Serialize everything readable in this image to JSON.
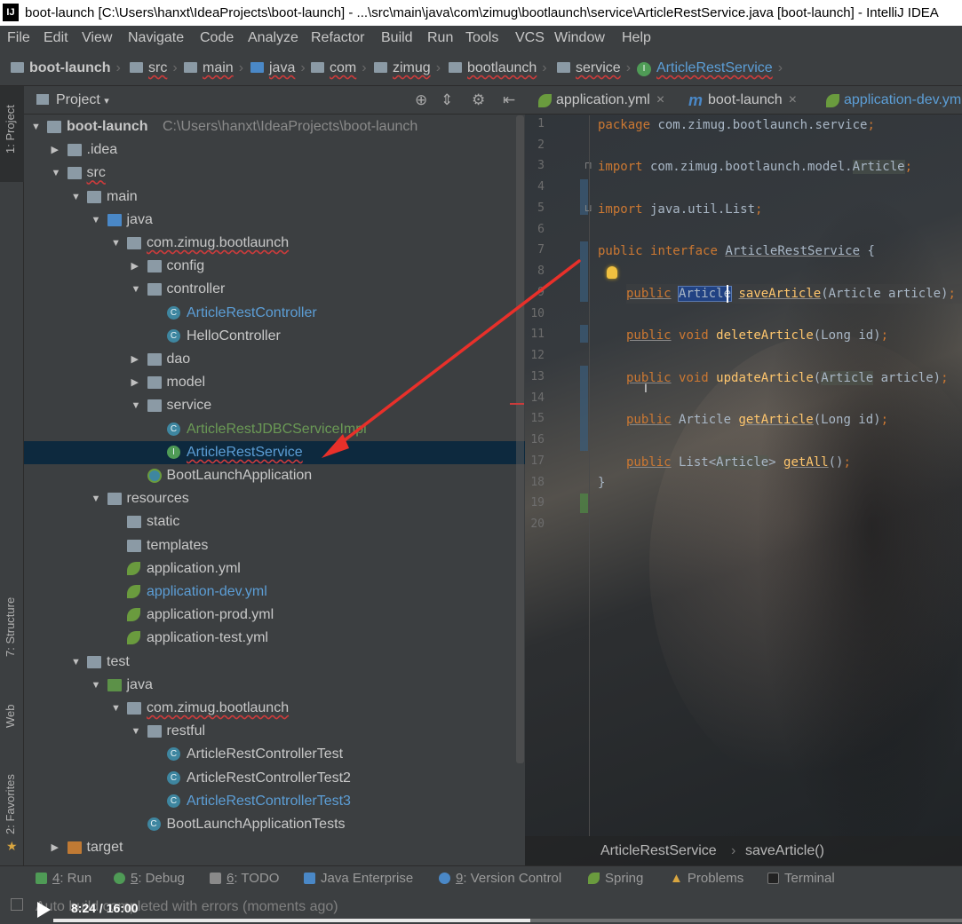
{
  "window": {
    "title": "boot-launch [C:\\Users\\hanxt\\IdeaProjects\\boot-launch] - ...\\src\\main\\java\\com\\zimug\\bootlaunch\\service\\ArticleRestService.java [boot-launch] - IntelliJ IDEA"
  },
  "menu": [
    "File",
    "Edit",
    "View",
    "Navigate",
    "Code",
    "Analyze",
    "Refactor",
    "Build",
    "Run",
    "Tools",
    "VCS",
    "Window",
    "Help"
  ],
  "breadcrumbs": [
    "boot-launch",
    "src",
    "main",
    "java",
    "com",
    "zimug",
    "bootlaunch",
    "service",
    "ArticleRestService"
  ],
  "left_strip": {
    "project": "1: Project",
    "structure": "7: Structure",
    "web": "Web",
    "favorites": "2: Favorites"
  },
  "project_panel": {
    "title": "Project",
    "tree": [
      {
        "label": "boot-launch",
        "path": "C:\\Users\\hanxt\\IdeaProjects\\boot-launch",
        "level": 0,
        "expanded": true,
        "icon": "folder"
      },
      {
        "label": ".idea",
        "level": 1,
        "expanded": false,
        "icon": "folder"
      },
      {
        "label": "src",
        "level": 1,
        "expanded": true,
        "icon": "folder"
      },
      {
        "label": "main",
        "level": 2,
        "expanded": true,
        "icon": "folder"
      },
      {
        "label": "java",
        "level": 3,
        "expanded": true,
        "icon": "folder-blue"
      },
      {
        "label": "com.zimug.bootlaunch",
        "level": 4,
        "expanded": true,
        "icon": "folder"
      },
      {
        "label": "config",
        "level": 5,
        "expanded": false,
        "icon": "folder"
      },
      {
        "label": "controller",
        "level": 5,
        "expanded": true,
        "icon": "folder"
      },
      {
        "label": "ArticleRestController",
        "level": 6,
        "icon": "class",
        "color": "blue"
      },
      {
        "label": "HelloController",
        "level": 6,
        "icon": "class"
      },
      {
        "label": "dao",
        "level": 5,
        "expanded": false,
        "icon": "folder"
      },
      {
        "label": "model",
        "level": 5,
        "expanded": false,
        "icon": "folder"
      },
      {
        "label": "service",
        "level": 5,
        "expanded": true,
        "icon": "folder"
      },
      {
        "label": "ArticleRestJDBCServiceImpl",
        "level": 6,
        "icon": "class",
        "color": "green"
      },
      {
        "label": "ArticleRestService",
        "level": 6,
        "icon": "interface",
        "color": "blue",
        "selected": true
      },
      {
        "label": "BootLaunchApplication",
        "level": 5,
        "icon": "app"
      },
      {
        "label": "resources",
        "level": 3,
        "expanded": true,
        "icon": "folder"
      },
      {
        "label": "static",
        "level": 4,
        "icon": "folder"
      },
      {
        "label": "templates",
        "level": 4,
        "icon": "folder"
      },
      {
        "label": "application.yml",
        "level": 4,
        "icon": "yml"
      },
      {
        "label": "application-dev.yml",
        "level": 4,
        "icon": "yml",
        "color": "blue"
      },
      {
        "label": "application-prod.yml",
        "level": 4,
        "icon": "yml"
      },
      {
        "label": "application-test.yml",
        "level": 4,
        "icon": "yml"
      },
      {
        "label": "test",
        "level": 2,
        "expanded": true,
        "icon": "folder"
      },
      {
        "label": "java",
        "level": 3,
        "expanded": true,
        "icon": "folder-green"
      },
      {
        "label": "com.zimug.bootlaunch",
        "level": 4,
        "expanded": true,
        "icon": "folder"
      },
      {
        "label": "restful",
        "level": 5,
        "expanded": true,
        "icon": "folder"
      },
      {
        "label": "ArticleRestControllerTest",
        "level": 6,
        "icon": "class"
      },
      {
        "label": "ArticleRestControllerTest2",
        "level": 6,
        "icon": "class"
      },
      {
        "label": "ArticleRestControllerTest3",
        "level": 6,
        "icon": "class",
        "color": "blue"
      },
      {
        "label": "BootLaunchApplicationTests",
        "level": 5,
        "icon": "class"
      },
      {
        "label": "target",
        "level": 1,
        "expanded": false,
        "icon": "folder-orange"
      }
    ]
  },
  "editor": {
    "tabs": [
      {
        "label": "application.yml",
        "icon": "yml"
      },
      {
        "label": "boot-launch",
        "icon": "maven"
      },
      {
        "label": "application-dev.yml",
        "icon": "yml"
      }
    ],
    "line_numbers": [
      "1",
      "2",
      "3",
      "4",
      "5",
      "6",
      "7",
      "8",
      "9",
      "10",
      "11",
      "12",
      "13",
      "14",
      "15",
      "16",
      "17",
      "18",
      "19",
      "20"
    ],
    "code": {
      "l1": [
        "package",
        " com.zimug.bootlaunch.service",
        ";"
      ],
      "l3": [
        "import",
        " com.zimug.bootlaunch.model.",
        "Article",
        ";"
      ],
      "l5": [
        "import",
        " java.util.List",
        ";"
      ],
      "l7": [
        "public",
        " ",
        "interface",
        " ",
        "ArticleRestService",
        " {"
      ],
      "l9": [
        "public",
        " ",
        "Article",
        " ",
        "saveArticle",
        "(Article article)",
        ";"
      ],
      "l11": [
        "public",
        " ",
        "void",
        " ",
        "deleteArticle",
        "(Long id)",
        ";"
      ],
      "l13": [
        "public",
        " ",
        "void",
        " ",
        "updateArticle",
        "(",
        "Article",
        " article)",
        ";"
      ],
      "l15": [
        "public",
        " Article ",
        "getArticle",
        "(Long id)",
        ";"
      ],
      "l17": [
        "public",
        " List<",
        "Article",
        "> ",
        "getAll",
        "()",
        ";"
      ],
      "l18": "}"
    },
    "status_breadcrumb": [
      "ArticleRestService",
      "saveArticle()"
    ]
  },
  "tool_windows": [
    {
      "num": "4",
      "label": ": Run"
    },
    {
      "num": "5",
      "label": ": Debug"
    },
    {
      "num": "6",
      "label": ": TODO"
    },
    {
      "num": "",
      "label": "Java Enterprise"
    },
    {
      "num": "9",
      "label": ": Version Control"
    },
    {
      "num": "",
      "label": "Spring"
    },
    {
      "num": "",
      "label": "Problems"
    },
    {
      "num": "",
      "label": "Terminal"
    }
  ],
  "status": {
    "message": "Auto build completed with errors (moments ago)"
  },
  "video": {
    "time": "8:24 / 16:00",
    "progress": 0.525
  },
  "colors": {
    "accent_blue": "#5c9ed6",
    "selection": "#0d293e",
    "arrow": "#e8302a",
    "keyword": "#cc7832"
  }
}
